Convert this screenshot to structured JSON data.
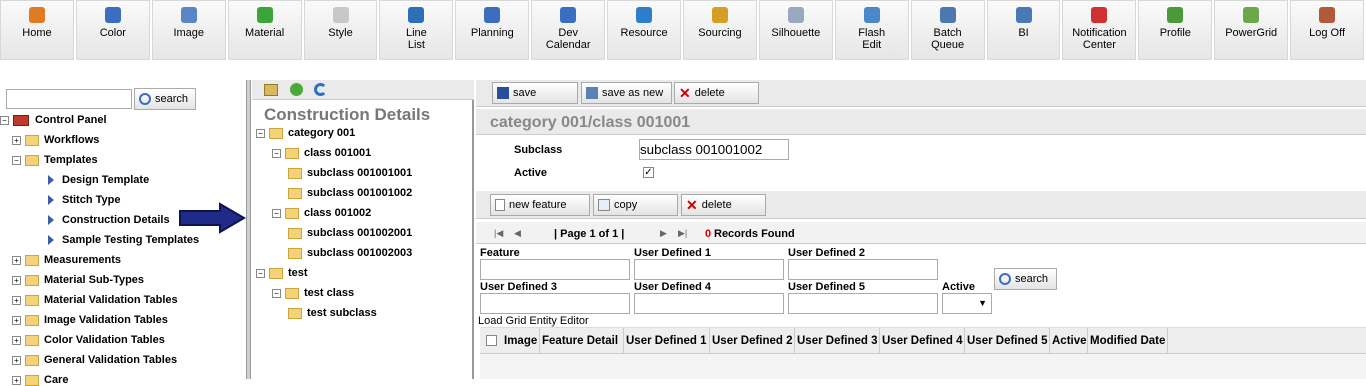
{
  "toolbar": [
    {
      "label": "Home",
      "icon": "home-icon",
      "color": "#e07b22"
    },
    {
      "label": "Color",
      "icon": "color-icon",
      "color": "#3a6fbf"
    },
    {
      "label": "Image",
      "icon": "image-icon",
      "color": "#5a86c6"
    },
    {
      "label": "Material",
      "icon": "material-icon",
      "color": "#3aa63a"
    },
    {
      "label": "Style",
      "icon": "style-icon",
      "color": "#c8c8c8"
    },
    {
      "label": "Line\nList",
      "icon": "line-list-icon",
      "color": "#2f6fb8"
    },
    {
      "label": "Planning",
      "icon": "planning-icon",
      "color": "#3a6fbf"
    },
    {
      "label": "Dev\nCalendar",
      "icon": "calendar-icon",
      "color": "#3a6fbf"
    },
    {
      "label": "Resource",
      "icon": "resource-icon",
      "color": "#2a7fc8"
    },
    {
      "label": "Sourcing",
      "icon": "sourcing-icon",
      "color": "#d4a020"
    },
    {
      "label": "Silhouette",
      "icon": "silhouette-icon",
      "color": "#9aa8c0"
    },
    {
      "label": "Flash\nEdit",
      "icon": "flash-edit-icon",
      "color": "#4a88c8"
    },
    {
      "label": "Batch\nQueue",
      "icon": "batch-queue-icon",
      "color": "#4a78b0"
    },
    {
      "label": "BI",
      "icon": "bi-icon",
      "color": "#4a78b0"
    },
    {
      "label": "Notification\nCenter",
      "icon": "notification-icon",
      "color": "#d03030"
    },
    {
      "label": "Profile",
      "icon": "profile-icon",
      "color": "#4a9a3a"
    },
    {
      "label": "PowerGrid",
      "icon": "powergrid-icon",
      "color": "#6aa84a"
    },
    {
      "label": "Log Off",
      "icon": "log-off-icon",
      "color": "#b05a3a"
    }
  ],
  "left": {
    "search_label": "search",
    "tree": [
      {
        "label": "Control Panel",
        "level": 0
      },
      {
        "label": "Workflows",
        "level": 1
      },
      {
        "label": "Templates",
        "level": 1
      },
      {
        "label": "Design Template",
        "level": 2
      },
      {
        "label": "Stitch Type",
        "level": 2
      },
      {
        "label": "Construction Details",
        "level": 2
      },
      {
        "label": "Sample Testing Templates",
        "level": 2
      },
      {
        "label": "Measurements",
        "level": 1
      },
      {
        "label": "Material Sub-Types",
        "level": 1
      },
      {
        "label": "Material Validation Tables",
        "level": 1
      },
      {
        "label": "Image Validation Tables",
        "level": 1
      },
      {
        "label": "Color Validation Tables",
        "level": 1
      },
      {
        "label": "General Validation Tables",
        "level": 1
      },
      {
        "label": "Care",
        "level": 1
      }
    ]
  },
  "mid": {
    "title": "Construction Details",
    "tree": [
      {
        "label": "category 001",
        "level": 0
      },
      {
        "label": "class 001001",
        "level": 1
      },
      {
        "label": "subclass 001001001",
        "level": 2
      },
      {
        "label": "subclass 001001002",
        "level": 2
      },
      {
        "label": "class 001002",
        "level": 1
      },
      {
        "label": "subclass 001002001",
        "level": 2
      },
      {
        "label": "subclass 001002003",
        "level": 2
      },
      {
        "label": "test",
        "level": 0
      },
      {
        "label": "test class",
        "level": 1
      },
      {
        "label": "test subclass",
        "level": 2
      }
    ]
  },
  "right": {
    "save": "save",
    "save_as_new": "save as new",
    "delete": "delete",
    "path": "category 001/class 001001",
    "subclass_label": "Subclass",
    "subclass_value": "subclass 001001002",
    "active_label": "Active",
    "new_feature": "new feature",
    "copy": "copy",
    "delete2": "delete",
    "page_text": "| Page 1 of 1 |",
    "records_count": "0",
    "records_label": "Records Found",
    "filters": {
      "feature": "Feature",
      "ud1": "User Defined 1",
      "ud2": "User Defined 2",
      "ud3": "User Defined 3",
      "ud4": "User Defined 4",
      "ud5": "User Defined 5",
      "active": "Active"
    },
    "search": "search",
    "editor_label": "Load Grid Entity Editor",
    "grid_headers": [
      "Image",
      "Feature Detail",
      "User Defined 1",
      "User Defined 2",
      "User Defined 3",
      "User Defined 4",
      "User Defined 5",
      "Active",
      "Modified Date"
    ]
  }
}
